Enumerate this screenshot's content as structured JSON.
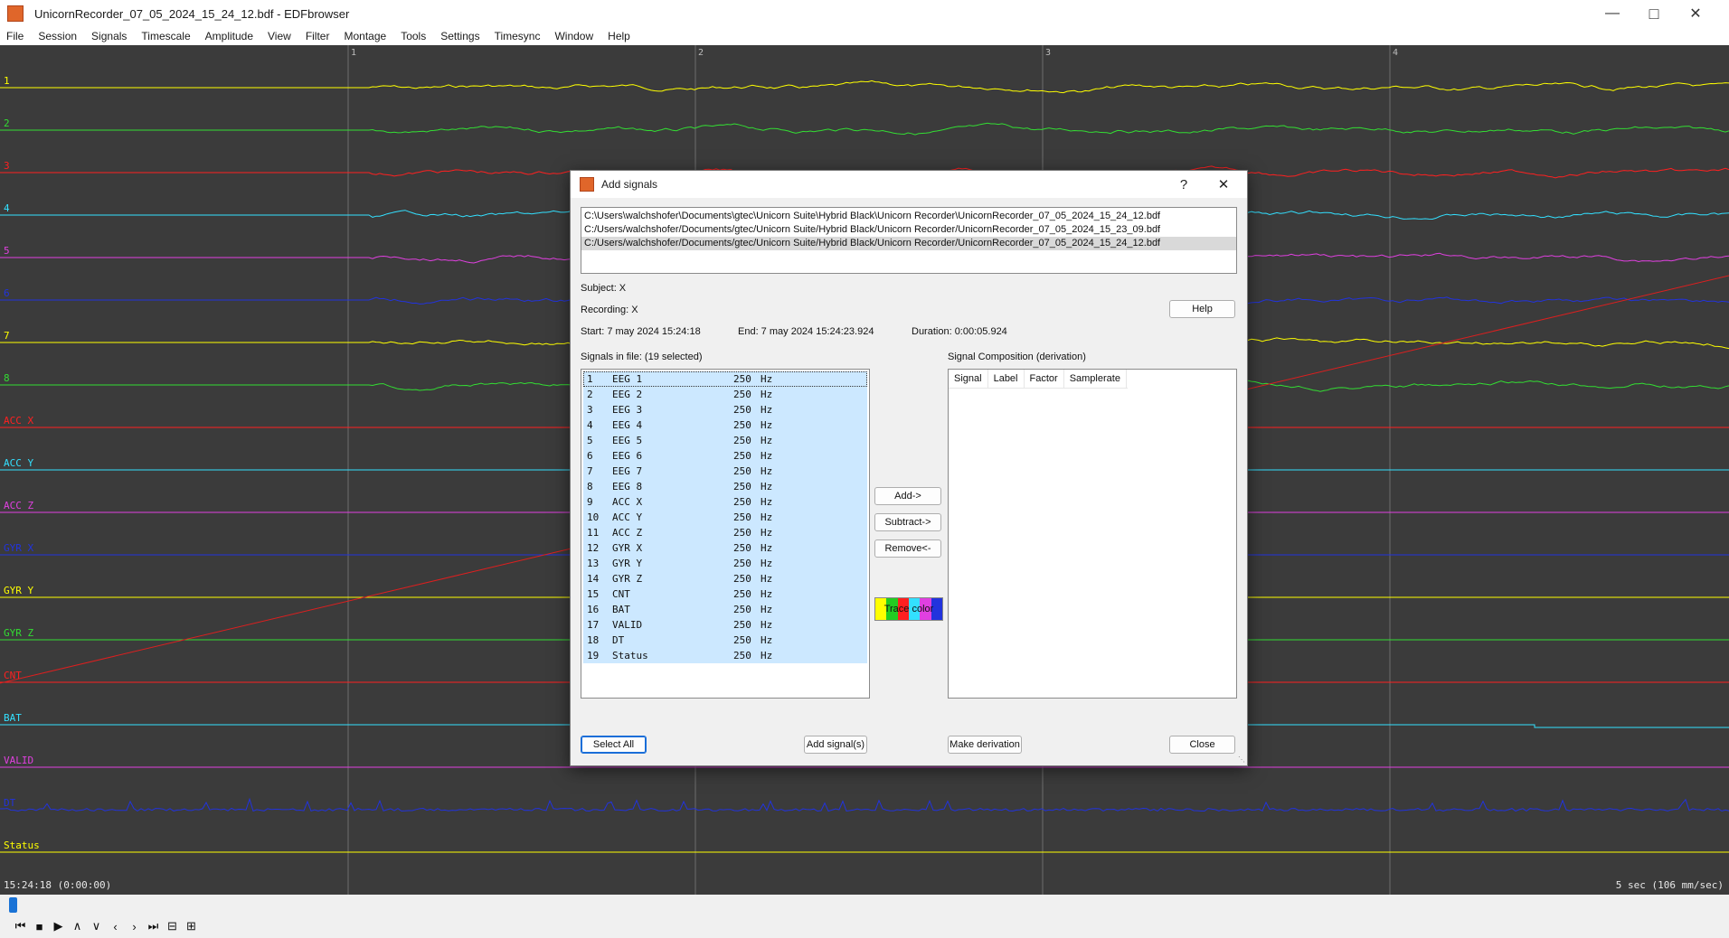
{
  "window": {
    "title": "UnicornRecorder_07_05_2024_15_24_12.bdf - EDFbrowser",
    "minimize": "—",
    "maximize": "□",
    "close": "✕"
  },
  "menu": [
    "File",
    "Session",
    "Signals",
    "Timescale",
    "Amplitude",
    "View",
    "Filter",
    "Montage",
    "Tools",
    "Settings",
    "Timesync",
    "Window",
    "Help"
  ],
  "canvas": {
    "second_markers": [
      "1",
      "2",
      "3",
      "4"
    ],
    "signals": [
      {
        "label": "1",
        "color": "#ffff00"
      },
      {
        "label": "2",
        "color": "#33dd33"
      },
      {
        "label": "3",
        "color": "#ff2020"
      },
      {
        "label": "4",
        "color": "#33e0ff"
      },
      {
        "label": "5",
        "color": "#e040e0"
      },
      {
        "label": "6",
        "color": "#2233dd"
      },
      {
        "label": "7",
        "color": "#ffff00"
      },
      {
        "label": "8",
        "color": "#33dd33"
      },
      {
        "label": "ACC X",
        "color": "#ff2020"
      },
      {
        "label": "ACC Y",
        "color": "#33e0ff"
      },
      {
        "label": "ACC Z",
        "color": "#e040e0"
      },
      {
        "label": "GYR X",
        "color": "#2233dd"
      },
      {
        "label": "GYR Y",
        "color": "#ffff00"
      },
      {
        "label": "GYR Z",
        "color": "#33dd33"
      },
      {
        "label": "CNT",
        "color": "#ff2020"
      },
      {
        "label": "BAT",
        "color": "#33e0ff"
      },
      {
        "label": "VALID",
        "color": "#e040e0"
      },
      {
        "label": "DT",
        "color": "#2233dd"
      },
      {
        "label": "Status",
        "color": "#ffff00"
      }
    ],
    "time_readout": "15:24:18 (0:00:00)",
    "scale_readout": "5 sec (106 mm/sec)"
  },
  "playback": {
    "progress_fraction": 0.0,
    "buttons": [
      {
        "name": "skip-start-icon",
        "glyph": "⏮"
      },
      {
        "name": "stop-icon",
        "glyph": "■"
      },
      {
        "name": "play-icon",
        "glyph": "▶"
      },
      {
        "name": "up-icon",
        "glyph": "∧"
      },
      {
        "name": "down-icon",
        "glyph": "∨"
      },
      {
        "name": "prev-icon",
        "glyph": "‹"
      },
      {
        "name": "next-icon",
        "glyph": "›"
      },
      {
        "name": "skip-end-icon",
        "glyph": "⏭"
      },
      {
        "name": "zoom-out-icon",
        "glyph": "⊟"
      },
      {
        "name": "zoom-in-icon",
        "glyph": "⊞"
      }
    ]
  },
  "dialog": {
    "title": "Add signals",
    "help_glyph": "?",
    "close_glyph": "✕",
    "files": [
      "C:\\Users\\walchshofer\\Documents\\gtec\\Unicorn Suite\\Hybrid Black\\Unicorn Recorder\\UnicornRecorder_07_05_2024_15_24_12.bdf",
      "C:/Users/walchshofer/Documents/gtec/Unicorn Suite/Hybrid Black/Unicorn Recorder/UnicornRecorder_07_05_2024_15_23_09.bdf",
      "C:/Users/walchshofer/Documents/gtec/Unicorn Suite/Hybrid Black/Unicorn Recorder/UnicornRecorder_07_05_2024_15_24_12.bdf"
    ],
    "subject": "Subject:  X",
    "recording": "Recording:  X",
    "start": "Start:  7 may 2024   15:24:18",
    "end": "End:  7 may 2024   15:24:23.924",
    "duration": "Duration:   0:00:05.924",
    "help_button": "Help",
    "signals_in_file_label": "Signals in file:   (19 selected)",
    "composition_label": "Signal Composition (derivation)",
    "composition_columns": [
      "Signal",
      "Label",
      "Factor",
      "Samplerate"
    ],
    "signals": [
      {
        "num": "1",
        "name": "EEG 1",
        "rate": "250",
        "unit": "Hz"
      },
      {
        "num": "2",
        "name": "EEG 2",
        "rate": "250",
        "unit": "Hz"
      },
      {
        "num": "3",
        "name": "EEG 3",
        "rate": "250",
        "unit": "Hz"
      },
      {
        "num": "4",
        "name": "EEG 4",
        "rate": "250",
        "unit": "Hz"
      },
      {
        "num": "5",
        "name": "EEG 5",
        "rate": "250",
        "unit": "Hz"
      },
      {
        "num": "6",
        "name": "EEG 6",
        "rate": "250",
        "unit": "Hz"
      },
      {
        "num": "7",
        "name": "EEG 7",
        "rate": "250",
        "unit": "Hz"
      },
      {
        "num": "8",
        "name": "EEG 8",
        "rate": "250",
        "unit": "Hz"
      },
      {
        "num": "9",
        "name": "ACC X",
        "rate": "250",
        "unit": "Hz"
      },
      {
        "num": "10",
        "name": "ACC Y",
        "rate": "250",
        "unit": "Hz"
      },
      {
        "num": "11",
        "name": "ACC Z",
        "rate": "250",
        "unit": "Hz"
      },
      {
        "num": "12",
        "name": "GYR X",
        "rate": "250",
        "unit": "Hz"
      },
      {
        "num": "13",
        "name": "GYR Y",
        "rate": "250",
        "unit": "Hz"
      },
      {
        "num": "14",
        "name": "GYR Z",
        "rate": "250",
        "unit": "Hz"
      },
      {
        "num": "15",
        "name": "CNT",
        "rate": "250",
        "unit": "Hz"
      },
      {
        "num": "16",
        "name": "BAT",
        "rate": "250",
        "unit": "Hz"
      },
      {
        "num": "17",
        "name": "VALID",
        "rate": "250",
        "unit": "Hz"
      },
      {
        "num": "18",
        "name": "DT",
        "rate": "250",
        "unit": "Hz"
      },
      {
        "num": "19",
        "name": "Status",
        "rate": "250",
        "unit": "Hz"
      }
    ],
    "add_button": "Add->",
    "subtract_button": "Subtract->",
    "remove_button": "Remove<-",
    "trace_color_label": "Trace color",
    "trace_colors": [
      "#ffff00",
      "#22cc22",
      "#ff2020",
      "#33e0ff",
      "#e040e0",
      "#2233dd"
    ],
    "select_all_button": "Select All",
    "add_signals_button": "Add signal(s)",
    "make_derivation_button": "Make derivation",
    "close_button": "Close"
  }
}
